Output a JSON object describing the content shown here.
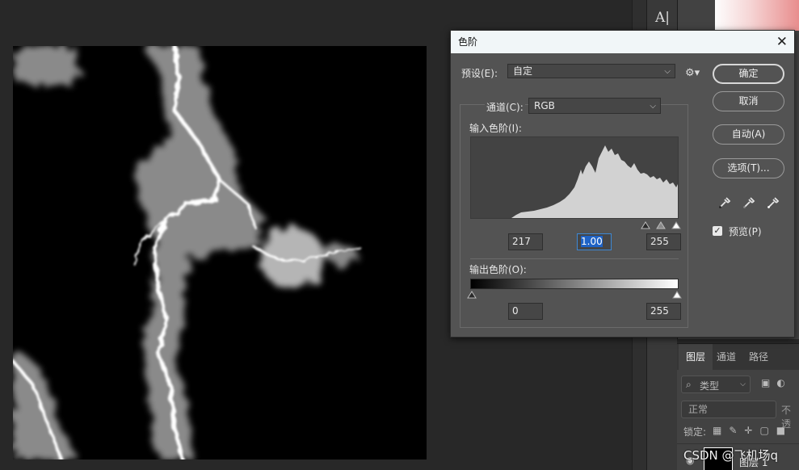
{
  "dialog": {
    "title": "色阶",
    "preset_label": "预设(E):",
    "preset_value": "自定",
    "channel_label": "通道(C):",
    "channel_value": "RGB",
    "input_levels_label": "输入色阶(I):",
    "input_values": {
      "black": "217",
      "gamma": "1.00",
      "white": "255"
    },
    "output_levels_label": "输出色阶(O):",
    "output_values": {
      "black": "0",
      "white": "255"
    },
    "buttons": {
      "ok": "确定",
      "cancel": "取消",
      "auto": "自动(A)",
      "options": "选项(T)..."
    },
    "preview_label": "预览(P)",
    "preview_checked": true,
    "eyedroppers": [
      "black-eyedropper-icon",
      "gray-eyedropper-icon",
      "white-eyedropper-icon"
    ]
  },
  "layers_panel": {
    "tabs": [
      "图层",
      "通道",
      "路径"
    ],
    "active_tab": "图层",
    "search_label": "类型",
    "blend_mode": "正常",
    "opacity_label": "不透",
    "lock_label": "锁定:",
    "layer_name": "图层 1"
  },
  "toolbar": {
    "text_tool_glyph": "A|"
  },
  "watermark": "CSDN @飞机场q",
  "colors": {
    "accent": "#1f63c6",
    "dialog_bg": "#535353",
    "title_bg": "#f1f6f8"
  }
}
